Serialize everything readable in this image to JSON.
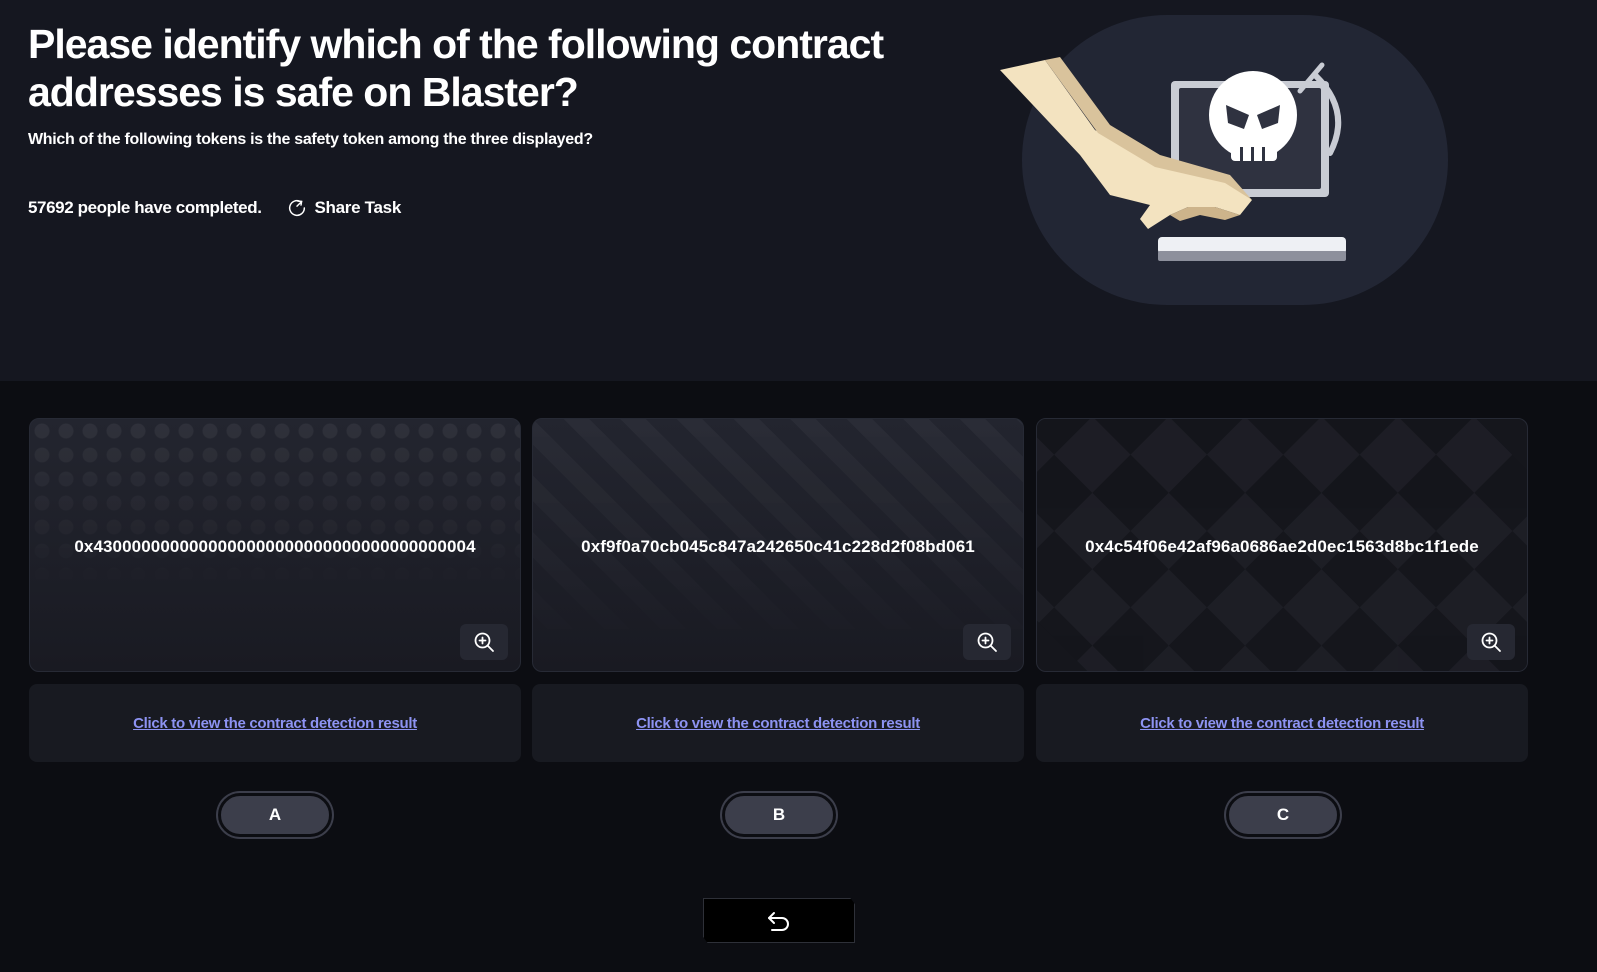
{
  "header": {
    "title": "Please identify which of the following contract addresses is safe on Blaster?",
    "subtitle": "Which of the following tokens is the safety token among the three displayed?",
    "completed_text": "57692 people have completed.",
    "share_label": "Share Task"
  },
  "cards": [
    {
      "address": "0x4300000000000000000000000000000000000004",
      "result_link": "Click to view the contract detection result",
      "option": "A"
    },
    {
      "address": "0xf9f0a70cb045c847a242650c41c228d2f08bd061",
      "result_link": "Click to view the contract detection result",
      "option": "B"
    },
    {
      "address": "0x4c54f06e42af96a0686ae2d0ec1563d8bc1f1ede",
      "result_link": "Click to view the contract detection result",
      "option": "C"
    }
  ],
  "icons": {
    "share": "share-icon",
    "zoom": "zoom-in-icon",
    "back": "back-arrow-icon",
    "illustration": "hacker-skull-laptop-illustration"
  },
  "colors": {
    "hero_bg": "#151720",
    "page_bg": "#0c0d12",
    "link": "#8d93f2",
    "option_bg": "#3c3e4b"
  }
}
